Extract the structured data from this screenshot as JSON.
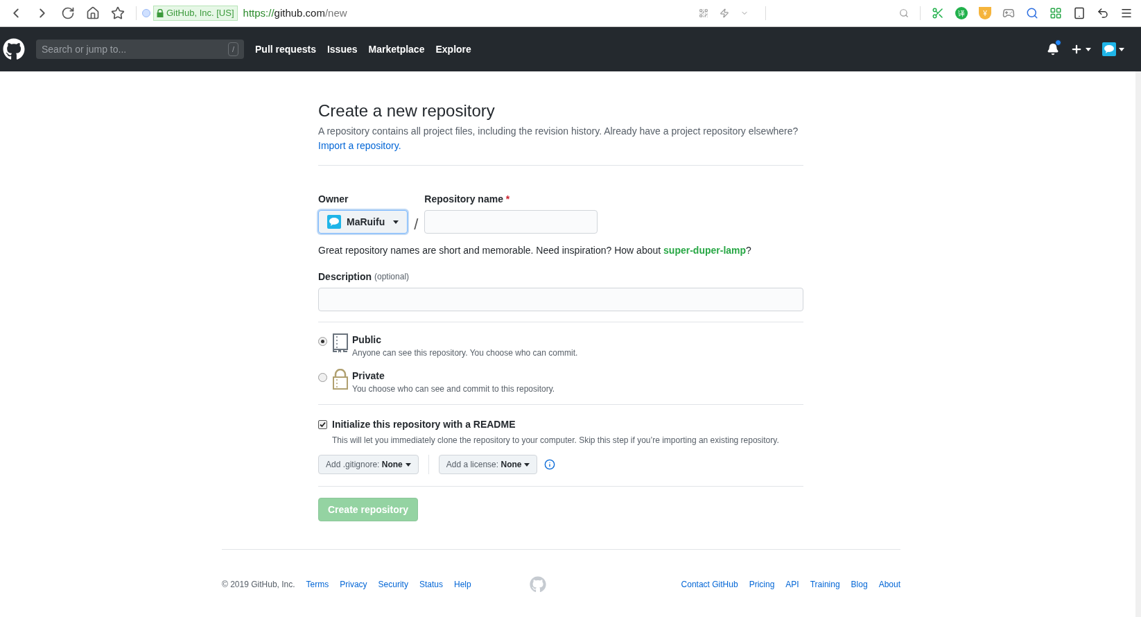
{
  "browser": {
    "security_badge": "GitHub, Inc. [US]",
    "url_scheme": "https://",
    "url_host": "github.com",
    "url_path": "/new",
    "extension_glyphs": [
      "译",
      "¥"
    ]
  },
  "header": {
    "search_placeholder": "Search or jump to...",
    "shortcut": "/",
    "nav": [
      "Pull requests",
      "Issues",
      "Marketplace",
      "Explore"
    ],
    "has_notification": true
  },
  "form": {
    "title": "Create a new repository",
    "subtitle": "A repository contains all project files, including the revision history. Already have a project repository elsewhere?",
    "import_link": "Import a repository.",
    "owner": {
      "label": "Owner",
      "value": "MaRuifu"
    },
    "separator": "/",
    "repo_name": {
      "label": "Repository name",
      "required_mark": "*"
    },
    "hint": "Great repository names are short and memorable. Need inspiration? How about **super-duper-lamp**?",
    "description": {
      "label": "Description",
      "optional": "(optional)"
    },
    "visibility": [
      {
        "kind": "public",
        "title": "Public",
        "text": "Anyone can see this repository. You choose who can commit.",
        "selected": true
      },
      {
        "kind": "private",
        "title": "Private",
        "text": "You choose who can see and commit to this repository.",
        "selected": false
      }
    ],
    "readme": {
      "label": "Initialize this repository with a README",
      "text": "This will let you immediately clone the repository to your computer. Skip this step if you’re importing an existing repository.",
      "checked": true
    },
    "dropdowns": [
      {
        "label": "Add .gitignore:",
        "value": "None"
      },
      {
        "label": "Add a license:",
        "value": "None"
      }
    ],
    "submit": {
      "label": "Create repository",
      "disabled": true
    }
  },
  "footer": {
    "copyright": "© 2019 GitHub, Inc.",
    "left_links": [
      "Terms",
      "Privacy",
      "Security",
      "Status",
      "Help"
    ],
    "right_links": [
      "Contact GitHub",
      "Pricing",
      "API",
      "Training",
      "Blog",
      "About"
    ]
  }
}
